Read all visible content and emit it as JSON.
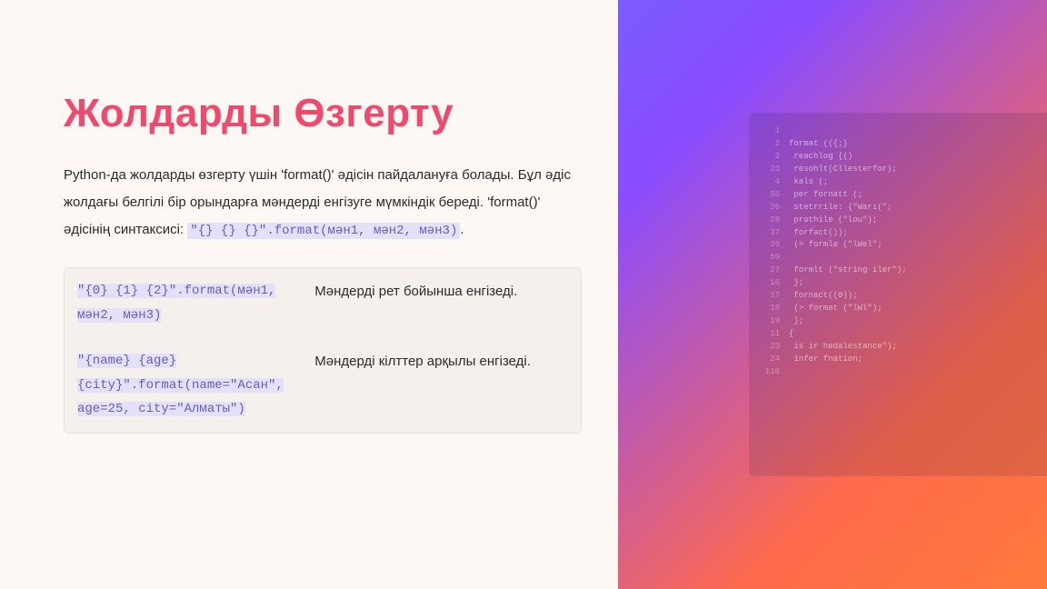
{
  "title": "Жолдарды Өзгерту",
  "paragraph": {
    "pre": "Python-да жолдарды өзгерту үшін 'format()' әдісін пайдалануға болады. Бұл әдіс жолдағы белгілі бір орындарға мәндерді енгізуге мүмкіндік береді. 'format()' әдісінің синтаксисі: ",
    "code": "\"{} {} {}\".format(мән1, мән2, мән3)",
    "post": "."
  },
  "table": {
    "rows": [
      {
        "code": "\"{0} {1} {2}\".format(мән1, мән2, мән3)",
        "desc": "Мәндерді рет бойынша енгізеді."
      },
      {
        "code": "\"{name} {age} {city}\".format(name=\"Асан\", age=25, city=\"Алматы\")",
        "desc": "Мәндерді кілттер арқылы енгізеді."
      }
    ]
  },
  "editor": {
    "lines": [
      {
        "n": "1",
        "t": ""
      },
      {
        "n": "2",
        "t": "format (({;}"
      },
      {
        "n": "2",
        "t": "  reachlog  {()"
      },
      {
        "n": "23",
        "t": "  resohlt(Cllesterfor);"
      },
      {
        "n": "4",
        "t": "    kals (;"
      },
      {
        "n": "55",
        "t": "    per fornatt (;"
      },
      {
        "n": "26",
        "t": "    stetrrile: {\"Warı(\";"
      },
      {
        "n": "29",
        "t": "      prothile (\"lou\");"
      },
      {
        "n": "37",
        "t": "    forfact());"
      },
      {
        "n": "39",
        "t": "    (> formle (\"lWel\";"
      },
      {
        "n": "59",
        "t": ""
      },
      {
        "n": "27",
        "t": "    formlt (\"string iler\");"
      },
      {
        "n": "16",
        "t": "  };"
      },
      {
        "n": "17",
        "t": "  fornact((0));"
      },
      {
        "n": "18",
        "t": "    (> format (\"lWl\");"
      },
      {
        "n": "19",
        "t": "  };"
      },
      {
        "n": "11",
        "t": "{"
      },
      {
        "n": "23",
        "t": "  is ir hedalestance\");"
      },
      {
        "n": "24",
        "t": "  infer fnation;"
      },
      {
        "n": "110",
        "t": ""
      }
    ]
  }
}
